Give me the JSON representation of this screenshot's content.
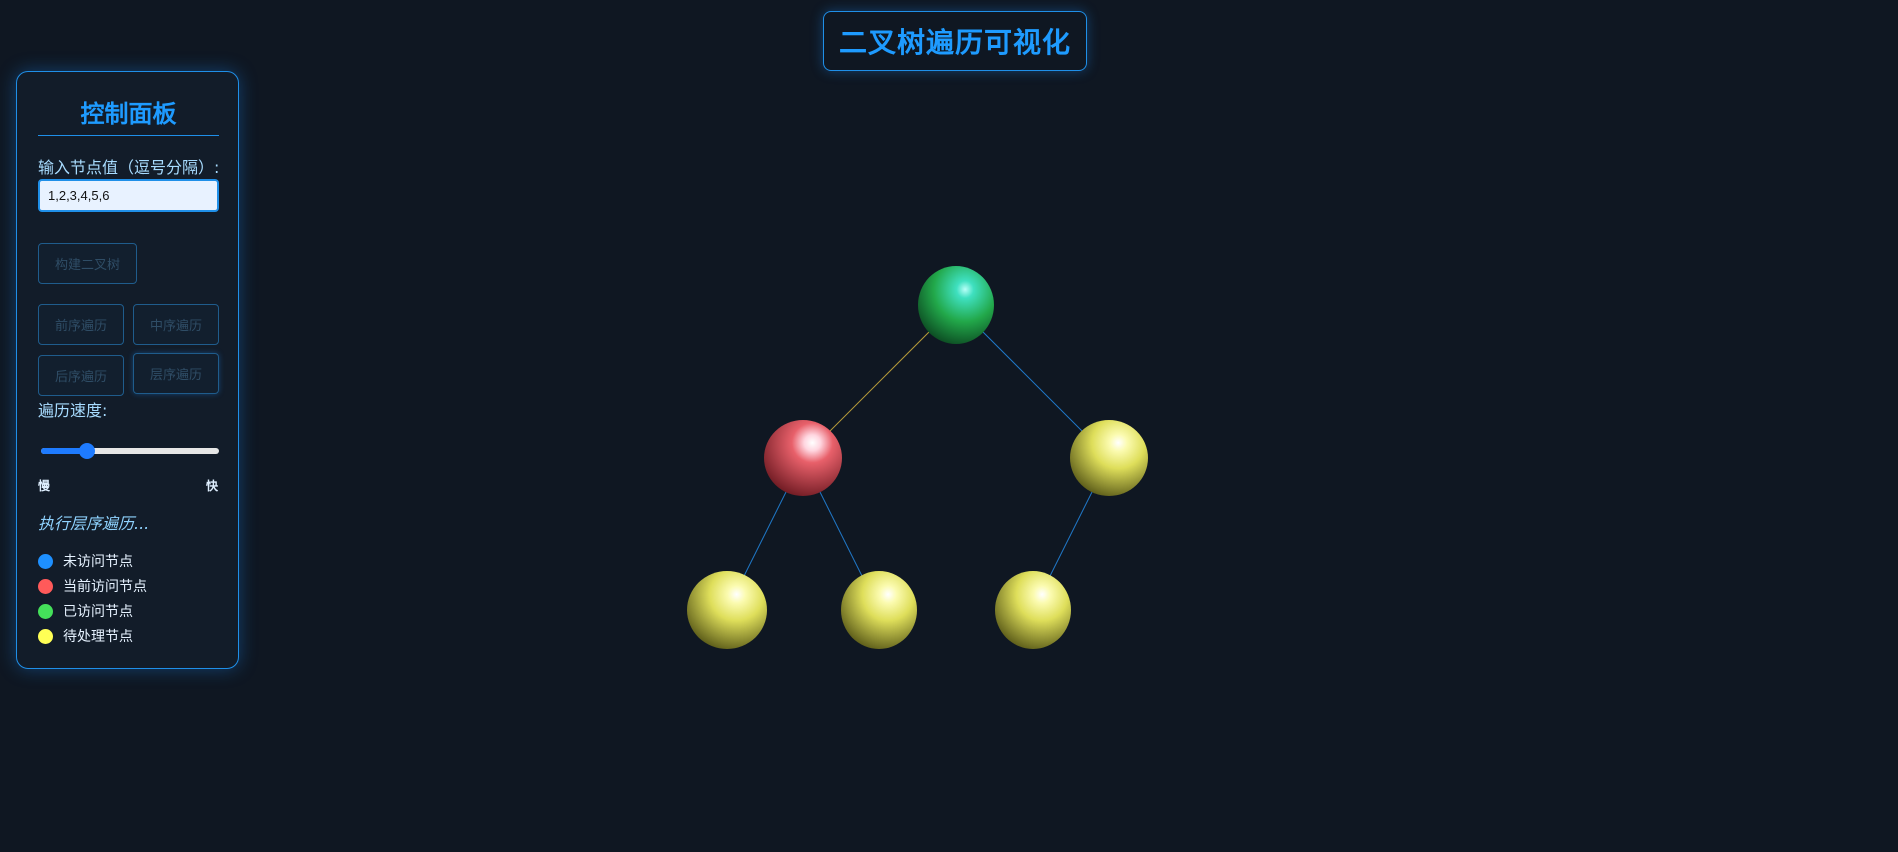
{
  "header": {
    "title": "二叉树遍历可视化"
  },
  "panel": {
    "title": "控制面板",
    "input_label": "输入节点值（逗号分隔）:",
    "input_value": "1,2,3,4,5,6",
    "build_button": "构建二叉树",
    "buttons": {
      "preorder": "前序遍历",
      "inorder": "中序遍历",
      "postorder": "后序遍历",
      "levelorder": "层序遍历"
    },
    "speed_label": "遍历速度:",
    "speed_value": 0.26,
    "speed_min_label": "慢",
    "speed_max_label": "快",
    "status": "执行层序遍历..."
  },
  "legend": [
    {
      "label": "未访问节点",
      "color": "#1e90ff"
    },
    {
      "label": "当前访问节点",
      "color": "#ff5a5a"
    },
    {
      "label": "已访问节点",
      "color": "#44e05a"
    },
    {
      "label": "待处理节点",
      "color": "#ffff55"
    }
  ],
  "tree": {
    "nodes": [
      {
        "id": 1,
        "state": "visited"
      },
      {
        "id": 2,
        "state": "current"
      },
      {
        "id": 3,
        "state": "pending"
      },
      {
        "id": 4,
        "state": "pending"
      },
      {
        "id": 5,
        "state": "pending"
      },
      {
        "id": 6,
        "state": "pending"
      }
    ],
    "edges": [
      {
        "from": 1,
        "to": 2,
        "color": "#b59a3a"
      },
      {
        "from": 1,
        "to": 3,
        "color": "#1f78c8"
      },
      {
        "from": 2,
        "to": 4,
        "color": "#1f78c8"
      },
      {
        "from": 2,
        "to": 5,
        "color": "#1f78c8"
      },
      {
        "from": 3,
        "to": 6,
        "color": "#1f78c8"
      }
    ]
  },
  "colors": {
    "accent": "#1e9bff",
    "background": "#0f1722",
    "visited": "#2ec85a",
    "current": "#e8505a",
    "pending": "#f0f060"
  }
}
